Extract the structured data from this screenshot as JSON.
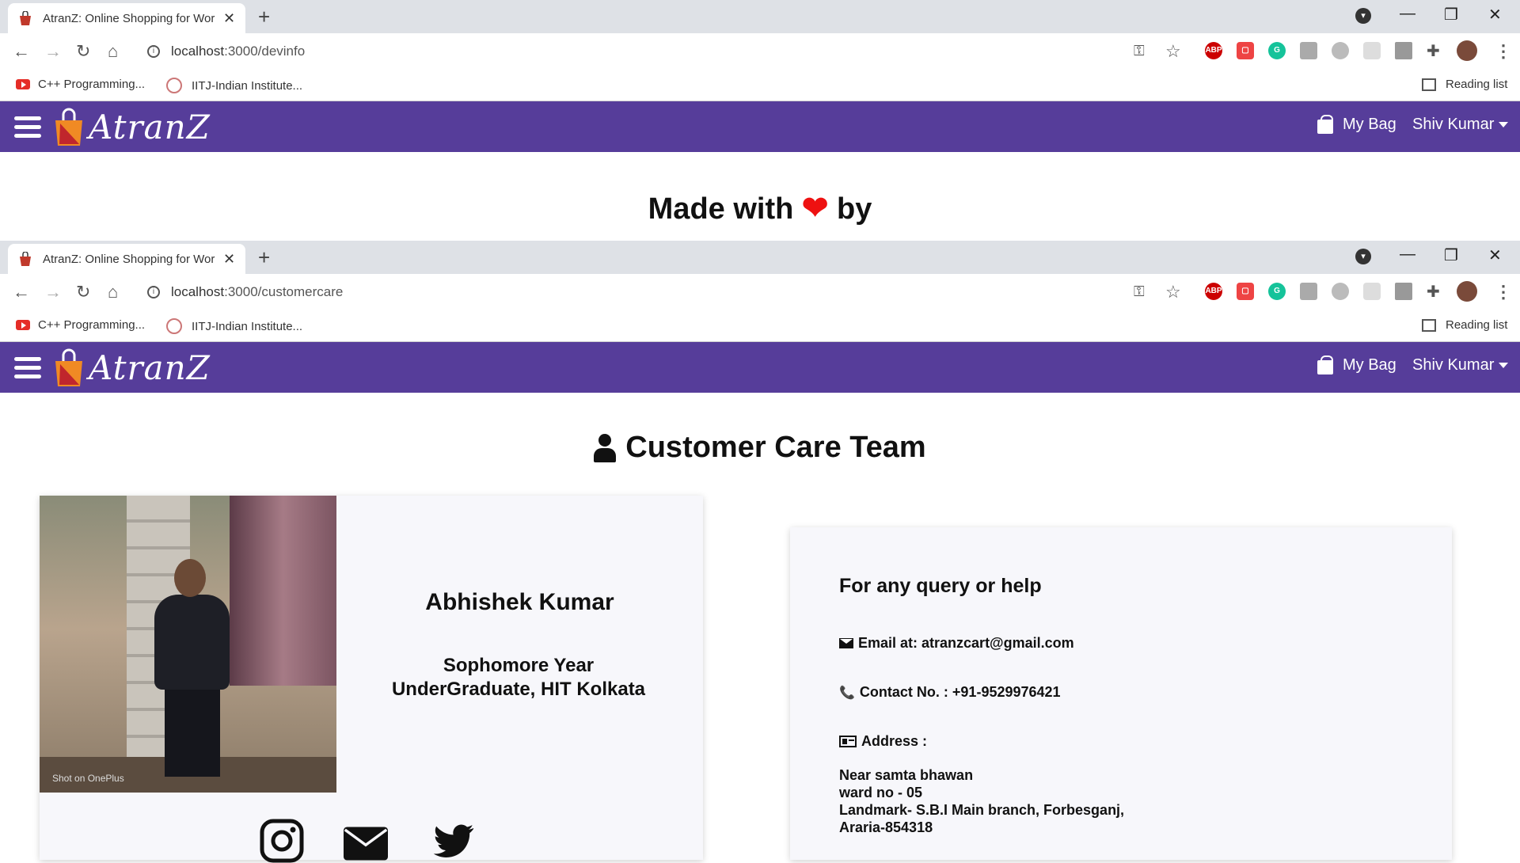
{
  "browser_top": {
    "tab_title": "AtranZ: Online Shopping for Wor",
    "url_host": "localhost",
    "url_path": ":3000/devinfo"
  },
  "browser_second": {
    "tab_title": "AtranZ: Online Shopping for Wor",
    "url_host": "localhost",
    "url_path": ":3000/customercare"
  },
  "bookmarks": {
    "items": [
      {
        "label": "C++ Programming...",
        "icon": "youtube-icon"
      },
      {
        "label": "IITJ-Indian Institute...",
        "icon": "iitj-icon"
      }
    ],
    "reading_list": "Reading list"
  },
  "extensions": [
    "ABP",
    "pocket",
    "grammarly",
    "ext",
    "ext",
    "shield",
    "metrics",
    "puzzle"
  ],
  "navbar": {
    "logo_text": "AtranZ",
    "bag_label": "My Bag",
    "user_name": "Shiv Kumar"
  },
  "devinfo": {
    "made_with": "Made with",
    "by": "by"
  },
  "customercare": {
    "title": "Customer Care Team",
    "member": {
      "name": "Abhishek Kumar",
      "role": "Sophomore Year UnderGraduate, HIT Kolkata",
      "photo_watermark": "Shot on OnePlus",
      "socials": [
        "instagram-icon",
        "envelope-icon",
        "twitter-icon"
      ]
    },
    "info": {
      "heading": "For any query or help",
      "email": "Email at: atranzcart@gmail.com",
      "contact": "Contact No. : +91-9529976421",
      "address_label": "Address :",
      "address_lines": [
        "Near samta bhawan",
        "ward no - 05",
        "Landmark- S.B.I Main branch, Forbesganj,",
        "Araria-854318"
      ]
    }
  },
  "colors": {
    "navbar": "#563d9a",
    "heart": "#ee1111",
    "tabstrip": "#dee1e6"
  }
}
